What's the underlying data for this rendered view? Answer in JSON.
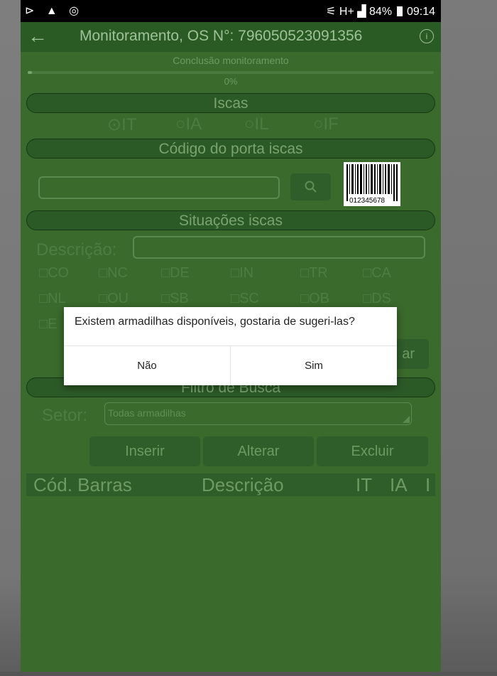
{
  "status_bar": {
    "left_icons": "⊳ ▲ ◎",
    "right_text": "⚟ H+ ▟ 84%",
    "battery_pct": "84%",
    "time": "09:14"
  },
  "app_bar": {
    "title": "Monitoramento, OS N°: 796050523091356"
  },
  "progress": {
    "label": "Conclusão monitoramento",
    "percent_text": "0%",
    "value": 0
  },
  "sections": {
    "iscas": "Iscas",
    "codigo": "Código do porta iscas",
    "situacoes": "Situações iscas",
    "filtro": "Filtro de Busca"
  },
  "radio_options": [
    "⊙IT",
    "○IA",
    "○IL",
    "○IF"
  ],
  "barcode_text": "012345678",
  "descricao_label": "Descrição:",
  "checkbox_row1": [
    "□CO",
    "□NC",
    "□DE",
    "□IN",
    "□TR",
    "□CA"
  ],
  "checkbox_row2": [
    "□NL",
    "□OU",
    "□SB",
    "□SC",
    "□OB",
    "□DS"
  ],
  "checkbox_row3": [
    "□E"
  ],
  "partial_button": "ar",
  "setor_label": "Setor:",
  "setor_value": "Todas armadilhas",
  "actions": {
    "inserir": "Inserir",
    "alterar": "Alterar",
    "excluir": "Excluir"
  },
  "table_headers": [
    "Cód. Barras",
    "Descrição",
    "IT",
    "IA",
    "I"
  ],
  "dialog": {
    "message": "Existem armadilhas disponíveis, gostaria de sugeri-las?",
    "no": "Não",
    "yes": "Sim"
  }
}
